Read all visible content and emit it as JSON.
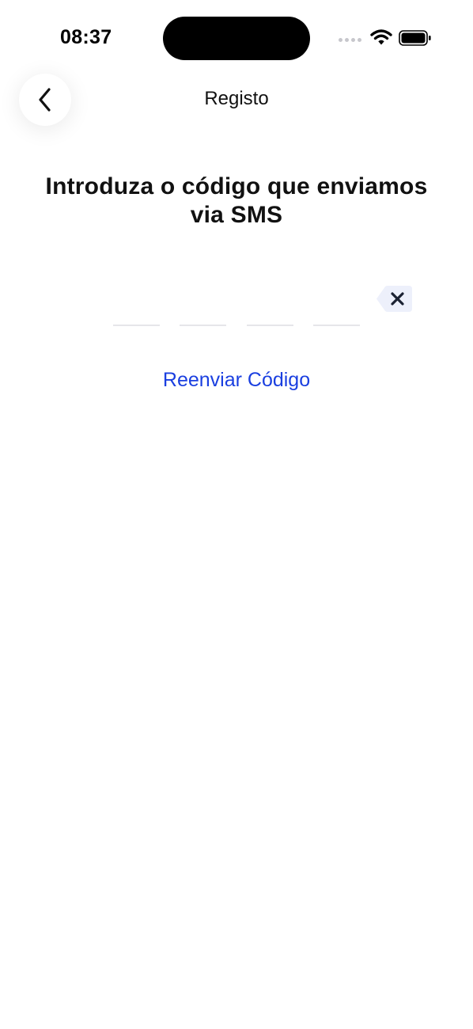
{
  "status_bar": {
    "time": "08:37",
    "icons": [
      "cellular-signal-icon",
      "wifi-icon",
      "battery-icon"
    ]
  },
  "nav": {
    "back_icon": "chevron-left-icon",
    "title": "Registo"
  },
  "main": {
    "heading": "Introduza o código que enviamos via SMS",
    "code_digits": [
      "",
      "",
      "",
      ""
    ],
    "clear_icon": "backspace-icon",
    "resend_label": "Reenviar Código"
  },
  "colors": {
    "accent": "#1a3fe0",
    "text": "#111111",
    "slot_line": "#e6e6ea",
    "clear_bg": "#edf0fb"
  }
}
